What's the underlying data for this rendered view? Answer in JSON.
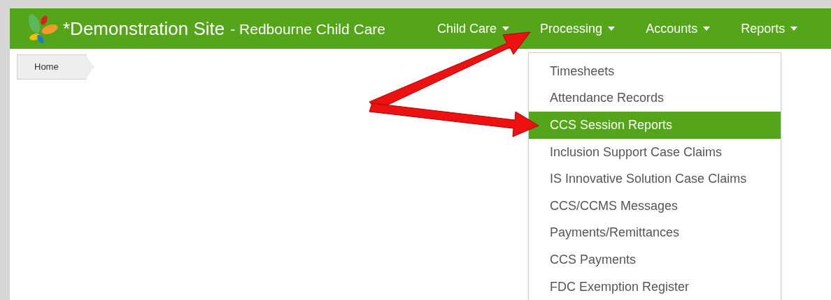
{
  "header": {
    "title": "*Demonstration Site",
    "subtitle": "- Redbourne Child Care"
  },
  "nav": [
    "Child Care",
    "Processing",
    "Accounts",
    "Reports"
  ],
  "breadcrumb": [
    "Home"
  ],
  "menu": [
    {
      "label": "Timesheets",
      "selected": false
    },
    {
      "label": "Attendance Records",
      "selected": false
    },
    {
      "label": "CCS Session Reports",
      "selected": true
    },
    {
      "label": "Inclusion Support Case Claims",
      "selected": false
    },
    {
      "label": "IS Innovative Solution Case Claims",
      "selected": false
    },
    {
      "label": "CCS/CCMS Messages",
      "selected": false
    },
    {
      "label": "Payments/Remittances",
      "selected": false
    },
    {
      "label": "CCS Payments",
      "selected": false
    },
    {
      "label": "FDC Exemption Register",
      "selected": false
    }
  ]
}
